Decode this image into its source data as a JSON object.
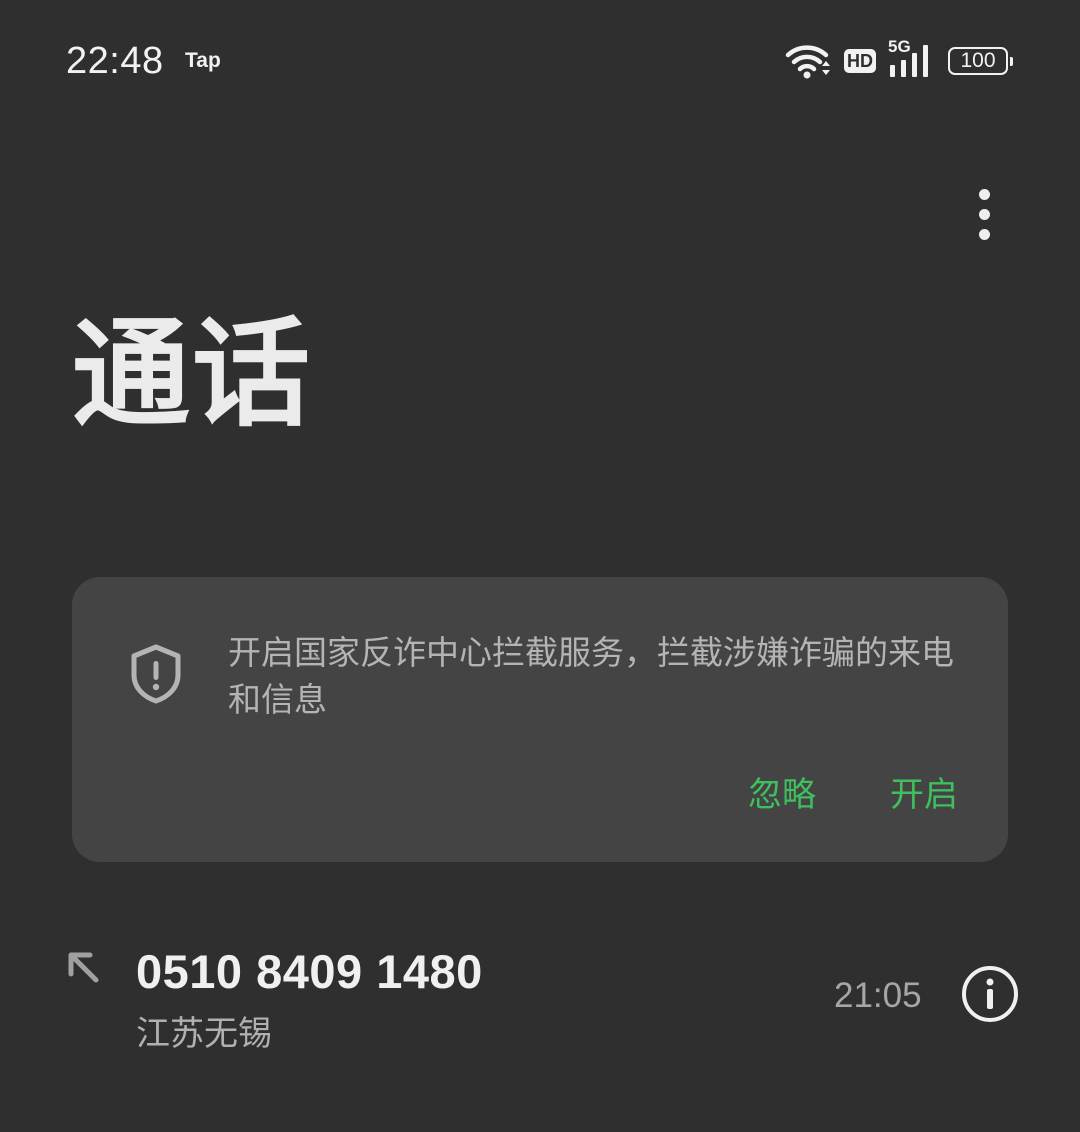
{
  "status_bar": {
    "time": "22:48",
    "app_label": "Tap",
    "hd_label": "HD",
    "network_label": "5G",
    "battery_level": "100"
  },
  "header": {
    "title": "通话",
    "more_icon": "more-vertical-icon"
  },
  "banner": {
    "icon": "shield-alert-icon",
    "message": "开启国家反诈中心拦截服务，拦截涉嫌诈骗的来电和信息",
    "ignore_label": "忽略",
    "enable_label": "开启",
    "accent_color": "#3fbf5d"
  },
  "call_log": [
    {
      "type_icon": "outgoing-call-arrow-icon",
      "number": "0510 8409 1480",
      "location": "江苏无锡",
      "time": "21:05",
      "info_icon": "info-icon"
    }
  ]
}
